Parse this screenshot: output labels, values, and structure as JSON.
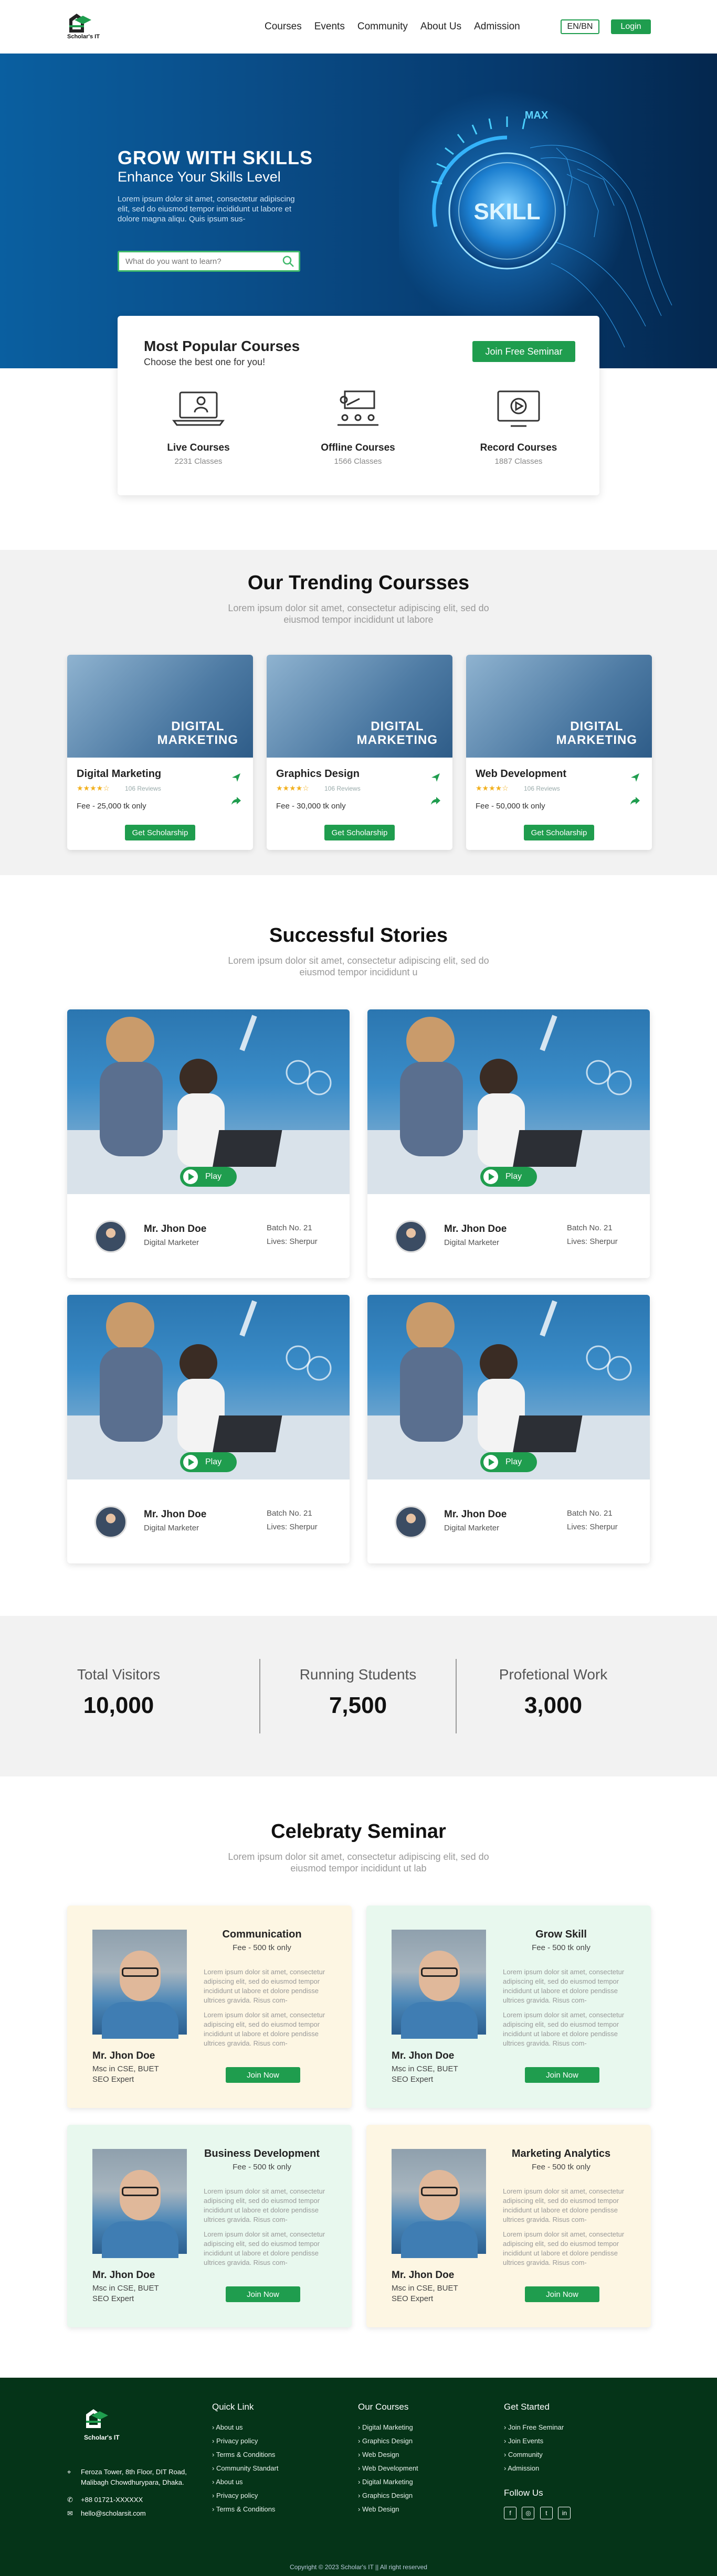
{
  "nav": {
    "logo_text": "Scholar's IT",
    "links": [
      "Courses",
      "Events",
      "Community",
      "About Us",
      "Admission"
    ],
    "lang": "EN/BN",
    "login": "Login"
  },
  "hero": {
    "title": "GROW WITH SKILLS",
    "subtitle": "Enhance Your Skills Level",
    "text": "Lorem ipsum dolor sit amet, consectetur adipiscing elit, sed do eiusmod tempor incididunt ut labore et dolore magna aliqu. Quis ipsum sus-",
    "search_placeholder": "What do you want to learn?",
    "knob_label": "SKILL",
    "knob_max": "MAX"
  },
  "popular": {
    "title": "Most Popular Courses",
    "subtitle": "Choose the best one for you!",
    "button": "Join Free Seminar",
    "items": [
      {
        "name": "Live Courses",
        "count": "2231 Classes",
        "icon": "laptop-teacher-icon"
      },
      {
        "name": "Offline Courses",
        "count": "1566 Classes",
        "icon": "classroom-icon"
      },
      {
        "name": "Record Courses",
        "count": "1887 Classes",
        "icon": "video-player-icon"
      }
    ]
  },
  "trending": {
    "title": "Our Trending Coursses",
    "subtitle": "Lorem ipsum dolor sit amet, consectetur adipiscing elit, sed do eiusmod tempor incididunt ut labore",
    "cards": [
      {
        "img_label1": "DIGITAL",
        "img_label2": "MARKETING",
        "title": "Digital Marketing",
        "stars": "★★★★☆",
        "reviews": "106 Reviews",
        "fee": "Fee - 25,000 tk only",
        "button": "Get Scholarship"
      },
      {
        "img_label1": "DIGITAL",
        "img_label2": "MARKETING",
        "title": "Graphics Design",
        "stars": "★★★★☆",
        "reviews": "106 Reviews",
        "fee": "Fee - 30,000 tk only",
        "button": "Get Scholarship"
      },
      {
        "img_label1": "DIGITAL",
        "img_label2": "MARKETING",
        "title": "Web Development",
        "stars": "★★★★☆",
        "reviews": "106 Reviews",
        "fee": "Fee - 50,000 tk only",
        "button": "Get Scholarship"
      }
    ]
  },
  "stories": {
    "title": "Successful Stories",
    "subtitle": "Lorem ipsum dolor sit amet, consectetur adipiscing elit, sed do eiusmod tempor incididunt u",
    "cards": [
      {
        "play": "Play",
        "name": "Mr. Jhon Doe",
        "role": "Digital Marketer",
        "batch": "Batch No. 21",
        "lives": "Lives:  Sherpur"
      },
      {
        "play": "Play",
        "name": "Mr. Jhon Doe",
        "role": "Digital Marketer",
        "batch": "Batch No. 21",
        "lives": "Lives:  Sherpur"
      },
      {
        "play": "Play",
        "name": "Mr. Jhon Doe",
        "role": "Digital Marketer",
        "batch": "Batch No. 21",
        "lives": "Lives:  Sherpur"
      },
      {
        "play": "Play",
        "name": "Mr. Jhon Doe",
        "role": "Digital Marketer",
        "batch": "Batch No. 21",
        "lives": "Lives:  Sherpur"
      }
    ]
  },
  "stats": [
    {
      "label": "Total Visitors",
      "value": "10,000"
    },
    {
      "label": "Running Students",
      "value": "7,500"
    },
    {
      "label": "Profetional Work",
      "value": "3,000"
    }
  ],
  "seminar": {
    "title": "Celebraty Seminar",
    "subtitle": "Lorem ipsum dolor sit amet, consectetur adipiscing elit, sed do eiusmod tempor incididunt ut lab",
    "para": "Lorem ipsum dolor sit amet, consectetur adipiscing elit, sed do eiusmod tempor incididunt ut labore et dolore pendisse ultrices gravida. Risus com-",
    "cards": [
      {
        "title": "Communication",
        "fee": "Fee - 500 tk only",
        "name": "Mr. Jhon Doe",
        "degree": "Msc in CSE, BUET",
        "role": "SEO Expert",
        "button": "Join Now",
        "bg": "#fdf6e3"
      },
      {
        "title": "Grow Skill",
        "fee": "Fee - 500 tk only",
        "name": "Mr. Jhon Doe",
        "degree": "Msc in CSE, BUET",
        "role": "SEO Expert",
        "button": "Join Now",
        "bg": "#e8f8ee"
      },
      {
        "title": "Business Development",
        "fee": "Fee - 500 tk only",
        "name": "Mr. Jhon Doe",
        "degree": "Msc in CSE, BUET",
        "role": "SEO Expert",
        "button": "Join Now",
        "bg": "#e8f8ee"
      },
      {
        "title": "Marketing Analytics",
        "fee": "Fee - 500 tk only",
        "name": "Mr. Jhon Doe",
        "degree": "Msc in CSE, BUET",
        "role": "SEO Expert",
        "button": "Join Now",
        "bg": "#fdf6e3"
      }
    ]
  },
  "footer": {
    "logo_text": "Scholar's IT",
    "address": "Feroza Tower, 8th Floor, DIT Road, Malibagh Chowdhurypara, Dhaka.",
    "phone": "+88 01721-XXXXXX",
    "email": "hello@scholarsit.com",
    "quick_links_title": "Quick Link",
    "quick_links": [
      "About us",
      "Privacy policy",
      "Terms & Conditions",
      "Community Standart",
      "About us",
      "Privacy policy",
      "Terms & Conditions"
    ],
    "courses_title": "Our Courses",
    "courses": [
      "Digital Marketing",
      "Graphics Design",
      "Web Design",
      "Web Development",
      "Digital Marketing",
      "Graphics Design",
      "Web Design"
    ],
    "started_title": "Get Started",
    "started": [
      "Join Free Seminar",
      "Join Events",
      "Community",
      "Admission"
    ],
    "follow_title": "Follow Us",
    "social": [
      "f",
      "◎",
      "t",
      "in"
    ],
    "copyright": "Copyright © 2023 Scholar's IT || All right reserved"
  },
  "colors": {
    "accent": "#1f9d4e",
    "hero": "#0a4d88",
    "footer": "#053418"
  }
}
